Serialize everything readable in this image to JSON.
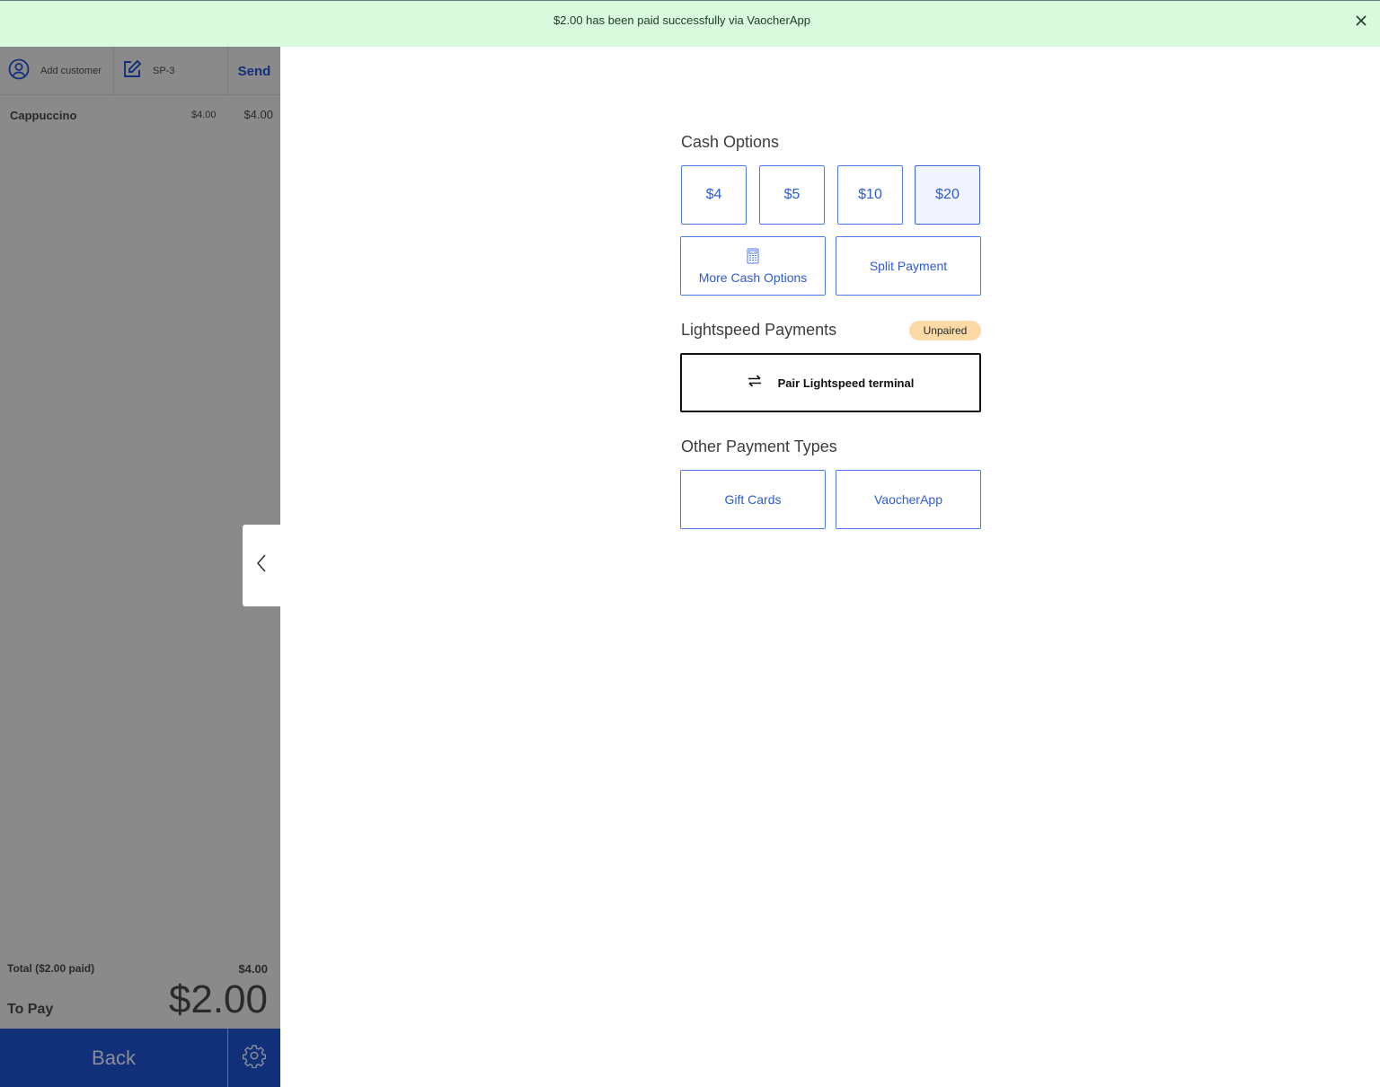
{
  "toast": {
    "message": "$2.00 has been paid successfully via VaocherApp",
    "close_icon": "close-icon"
  },
  "sidebar": {
    "header": {
      "customer_label": "Add customer",
      "customer_icon": "user-circle-icon",
      "note_label": "SP-3",
      "note_icon": "edit-icon",
      "send_label": "Send"
    },
    "line_items": [
      {
        "name": "Cappuccino",
        "unit_price": "$4.00",
        "total": "$4.00"
      }
    ],
    "collapse_icon": "chevron-left-icon",
    "totals": {
      "total_label": "Total ($2.00 paid)",
      "total_value": "$4.00",
      "to_pay_label": "To Pay",
      "to_pay_value": "$2.00"
    },
    "footer": {
      "back_label": "Back",
      "settings_icon": "gear-icon"
    }
  },
  "main": {
    "cash_options": {
      "title": "Cash Options",
      "amounts": [
        "$4",
        "$5",
        "$10",
        "$20"
      ],
      "selected": "$20",
      "more_label": "More Cash Options",
      "more_icon": "calculator-icon",
      "split_label": "Split Payment"
    },
    "lightspeed": {
      "title": "Lightspeed Payments",
      "status_badge": "Unpaired",
      "pair_label": "Pair Lightspeed terminal",
      "pair_icon": "swap-arrows-icon"
    },
    "other": {
      "title": "Other Payment Types",
      "options": [
        "Gift Cards",
        "VaocherApp"
      ]
    }
  },
  "colors": {
    "toast_bg": "#d9fadc",
    "sidebar_overlay": "#8a8a8a",
    "brand_blue": "#12307a",
    "accent_blue": "#2f5bd3",
    "badge_bg": "#fcdaa6"
  }
}
